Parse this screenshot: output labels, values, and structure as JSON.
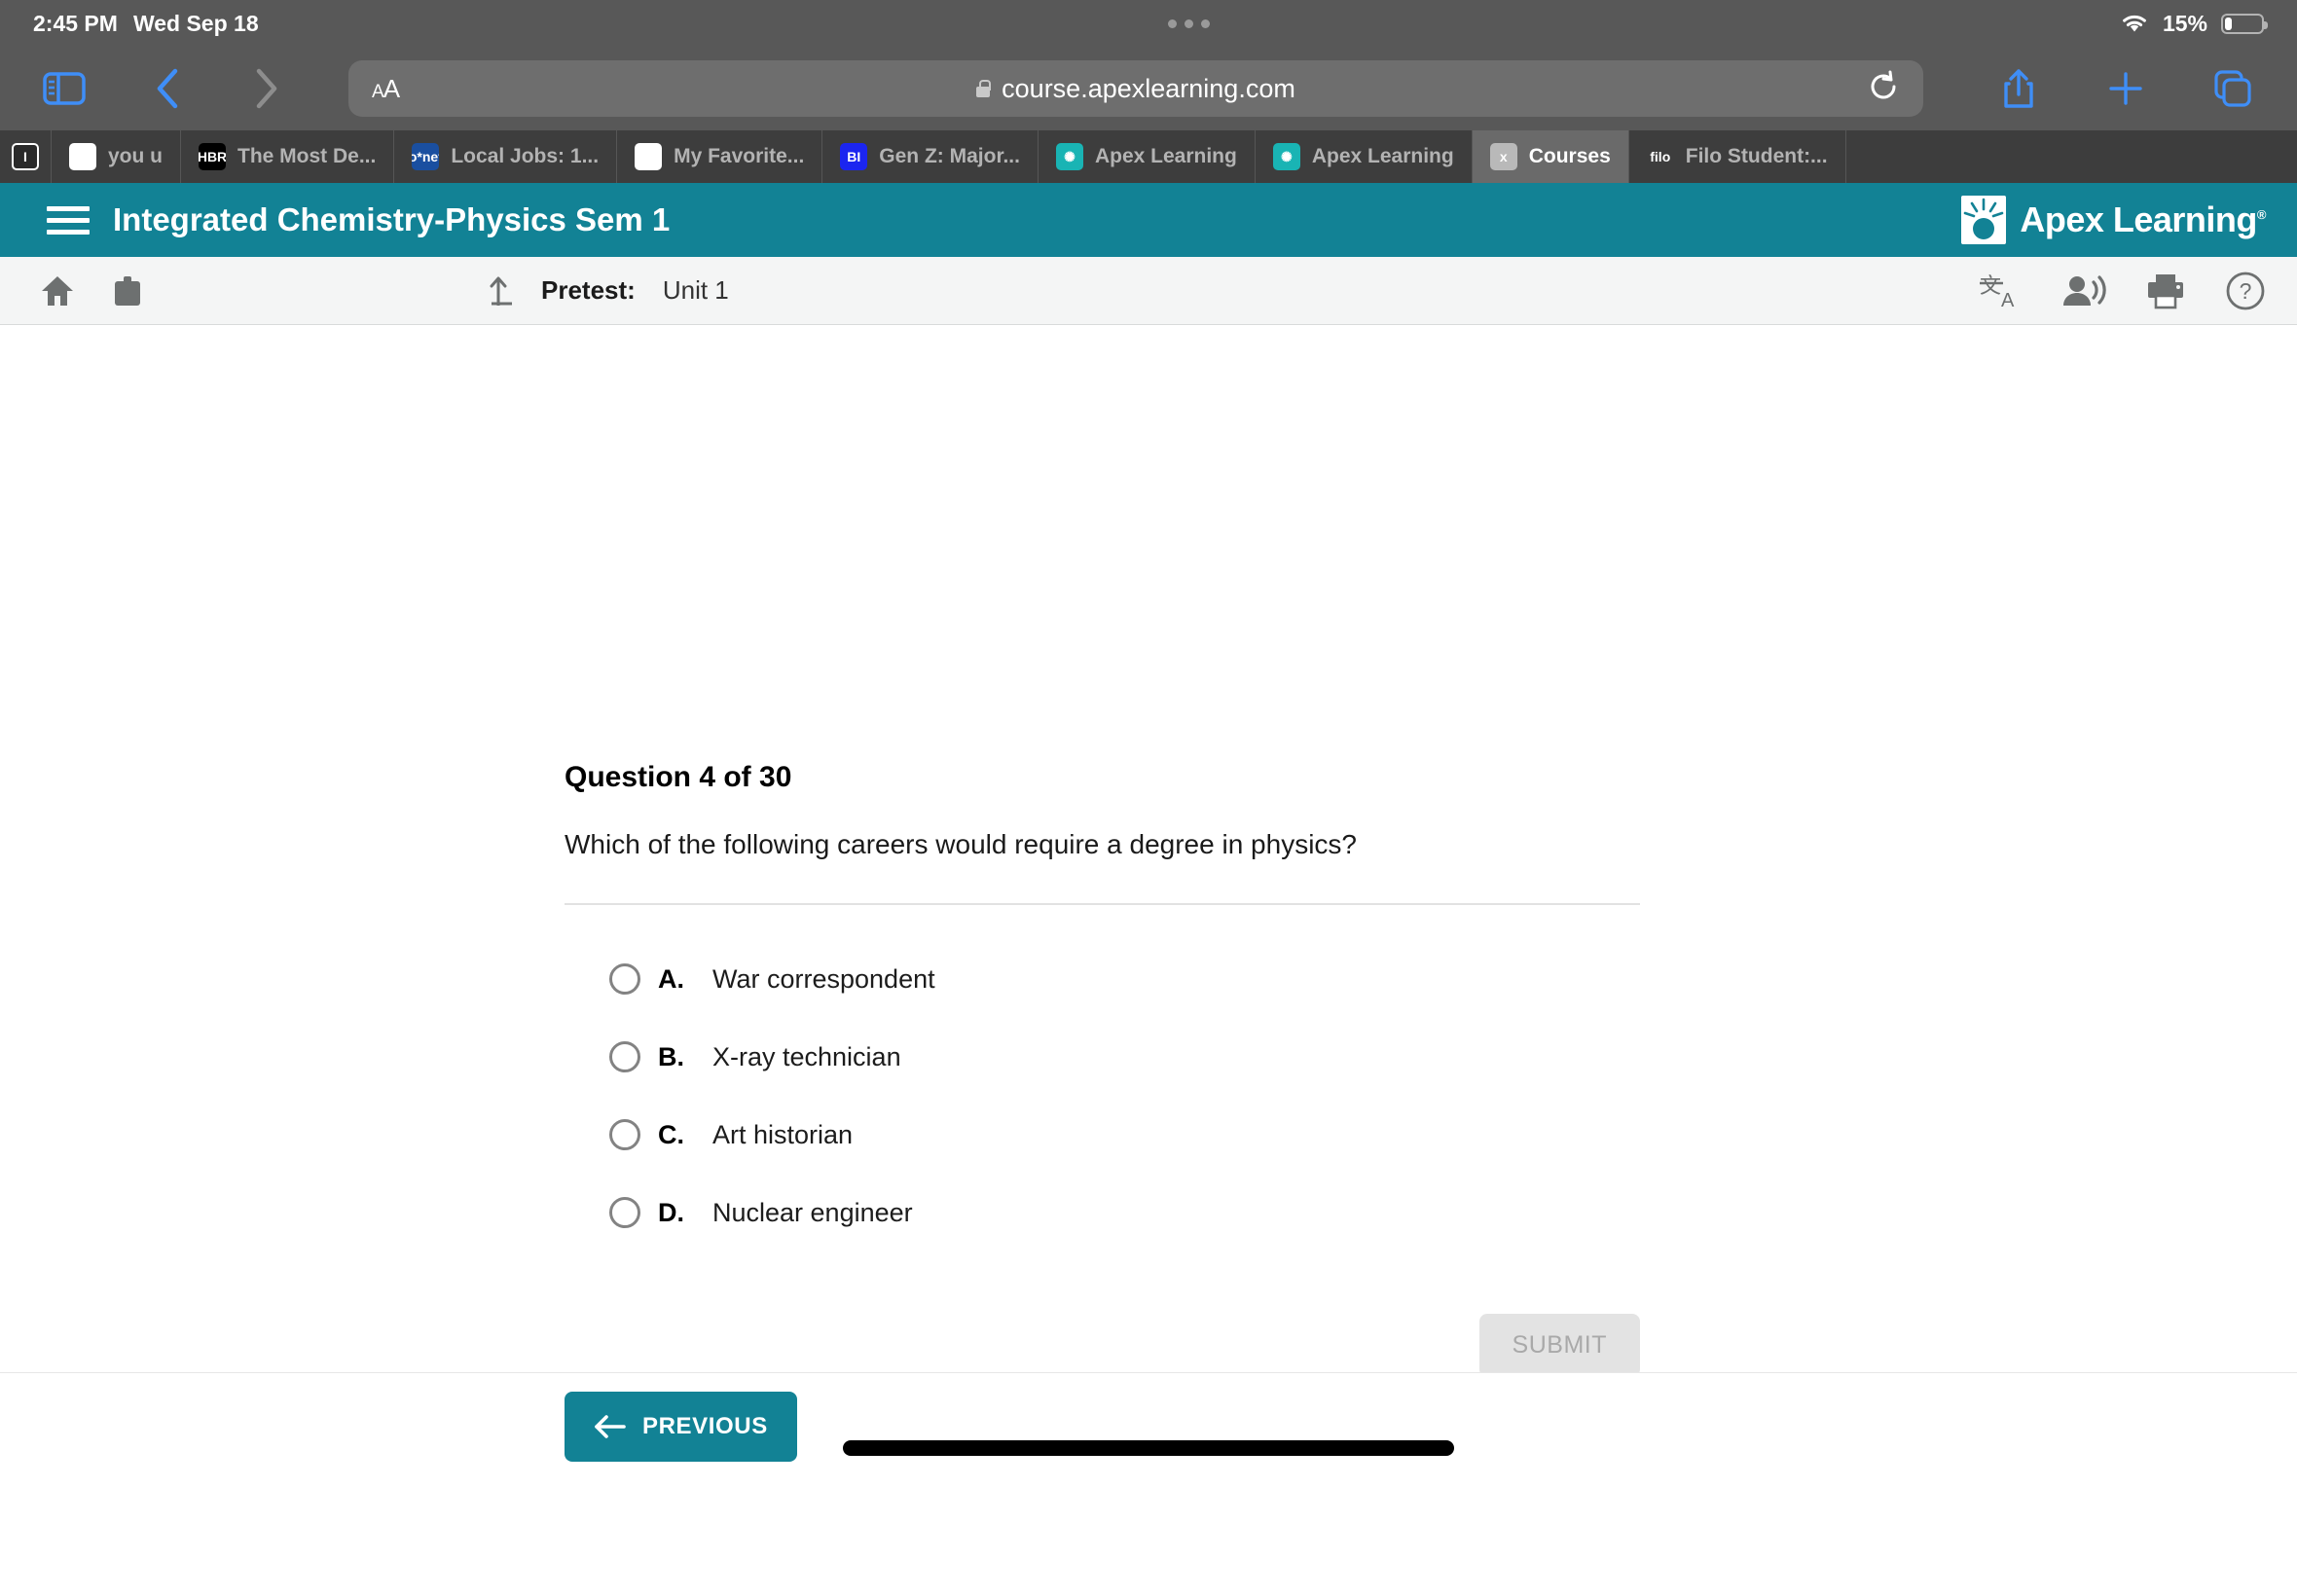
{
  "status_bar": {
    "time": "2:45 PM",
    "date": "Wed Sep 18",
    "battery_percent": "15%",
    "wifi_icon": "wifi-icon",
    "battery_icon": "battery-icon"
  },
  "browser": {
    "sidebar_icon": "sidebar-toggle-icon",
    "back_icon": "chevron-left-icon",
    "forward_icon": "chevron-right-icon",
    "text_size_label": "AA",
    "lock_icon": "lock-icon",
    "url": "course.apexlearning.com",
    "reload_icon": "reload-icon",
    "share_icon": "share-icon",
    "new_tab_icon": "plus-icon",
    "tabs_overview_icon": "tabs-overview-icon",
    "tabs": [
      {
        "title": "",
        "favicon": "instapaper-icon",
        "favicon_class": "fav-i",
        "favicon_text": "I",
        "active": false,
        "narrow": true
      },
      {
        "title": "you u",
        "favicon": "google-icon",
        "favicon_class": "fav-g",
        "favicon_text": "G",
        "active": false,
        "narrow": false
      },
      {
        "title": "The Most De...",
        "favicon": "hbr-icon",
        "favicon_class": "fav-hbr",
        "favicon_text": "HBR",
        "active": false,
        "narrow": false
      },
      {
        "title": "Local Jobs: 1...",
        "favicon": "onet-icon",
        "favicon_class": "fav-onet",
        "favicon_text": "o*net",
        "active": false,
        "narrow": false
      },
      {
        "title": "My Favorite...",
        "favicon": "zety-icon",
        "favicon_class": "fav-z",
        "favicon_text": "z",
        "active": false,
        "narrow": false
      },
      {
        "title": "Gen Z: Major...",
        "favicon": "business-insider-icon",
        "favicon_class": "fav-bi",
        "favicon_text": "BI",
        "active": false,
        "narrow": false
      },
      {
        "title": "Apex Learning",
        "favicon": "apex-learning-icon",
        "favicon_class": "fav-apex",
        "favicon_text": "✺",
        "active": false,
        "narrow": false
      },
      {
        "title": "Apex Learning",
        "favicon": "apex-learning-icon",
        "favicon_class": "fav-apex",
        "favicon_text": "✺",
        "active": false,
        "narrow": false
      },
      {
        "title": "Courses",
        "favicon": "generic-x-icon",
        "favicon_class": "fav-x",
        "favicon_text": "x",
        "active": true,
        "narrow": false
      },
      {
        "title": "Filo Student:...",
        "favicon": "filo-icon",
        "favicon_class": "fav-filo",
        "favicon_text": "filo",
        "active": false,
        "narrow": false
      }
    ]
  },
  "apex_header": {
    "menu_icon": "hamburger-menu-icon",
    "course_title": "Integrated Chemistry-Physics Sem 1",
    "logo_text": "Apex Learning",
    "logo_trademark": "®",
    "background_color": "#128295"
  },
  "sub_toolbar": {
    "home_icon": "home-icon",
    "briefcase_icon": "briefcase-icon",
    "up_arrow_icon": "navigate-up-icon",
    "breadcrumb_label": "Pretest:",
    "breadcrumb_value": "Unit 1",
    "translate_icon": "translate-icon",
    "read_aloud_icon": "read-aloud-icon",
    "print_icon": "print-icon",
    "help_icon": "help-circle-icon"
  },
  "question": {
    "number_label": "Question 4 of 30",
    "prompt": "Which of the following careers would require a degree in physics?",
    "choices": [
      {
        "letter": "A.",
        "text": "War correspondent",
        "selected": false
      },
      {
        "letter": "B.",
        "text": "X-ray technician",
        "selected": false
      },
      {
        "letter": "C.",
        "text": "Art historian",
        "selected": false
      },
      {
        "letter": "D.",
        "text": "Nuclear engineer",
        "selected": false
      }
    ],
    "submit_label": "SUBMIT",
    "submit_enabled": false
  },
  "footer": {
    "previous_label": "PREVIOUS",
    "previous_icon": "arrow-left-icon",
    "home_indicator": "home-indicator"
  }
}
